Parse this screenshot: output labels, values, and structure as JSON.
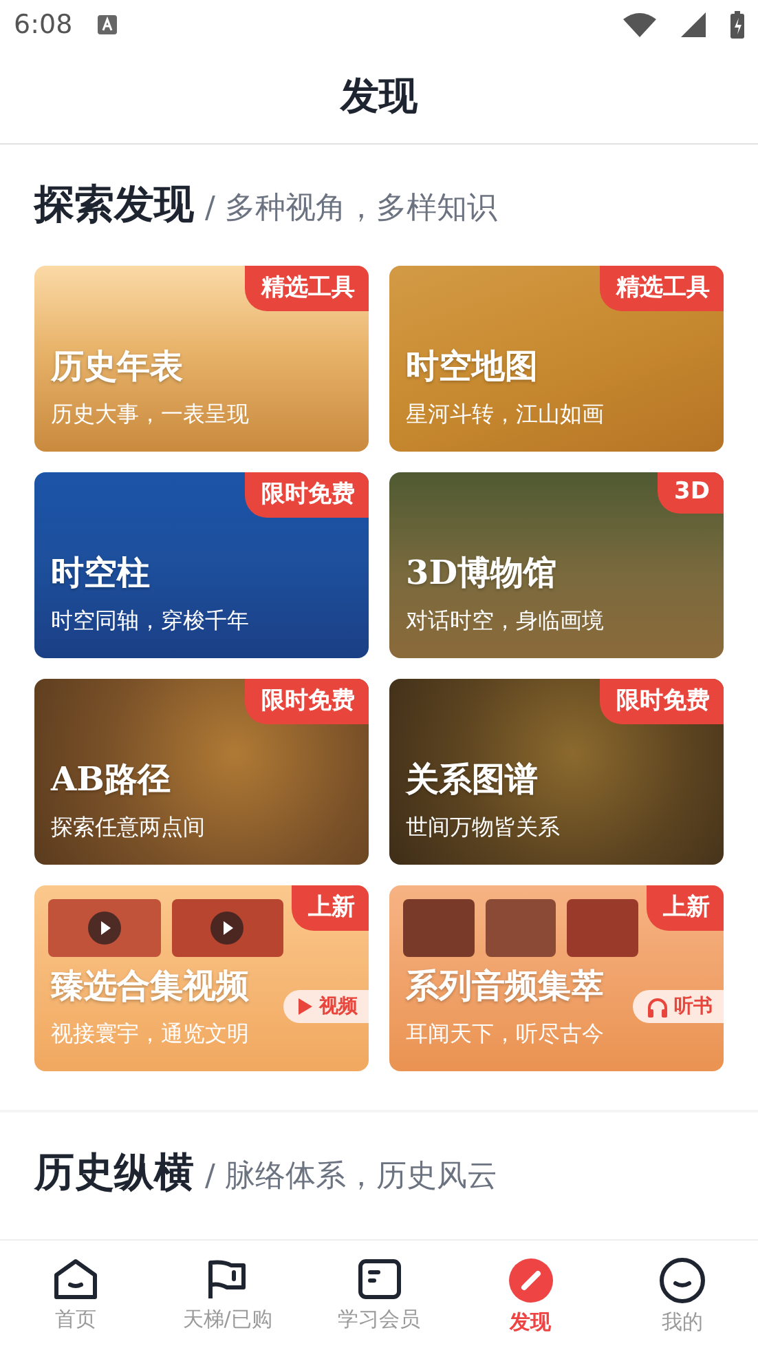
{
  "status_bar": {
    "time": "6:08"
  },
  "header": {
    "title": "发现"
  },
  "sections": [
    {
      "title": "探索发现",
      "subtitle": "/ 多种视角，多样知识",
      "cards": [
        {
          "kind": "tool",
          "title": "历史年表",
          "subtitle": "历史大事，一表呈现",
          "badge": "精选工具"
        },
        {
          "kind": "tool",
          "title": "时空地图",
          "subtitle": "星河斗转，江山如画",
          "badge": "精选工具"
        },
        {
          "kind": "tool",
          "title": "时空柱",
          "subtitle": "时空同轴，穿梭千年",
          "badge": "限时免费"
        },
        {
          "kind": "tool",
          "title": "3D博物馆",
          "subtitle": "对话时空，身临画境",
          "badge": "3D"
        },
        {
          "kind": "tool",
          "title": "AB路径",
          "subtitle": "探索任意两点间",
          "badge": "限时免费"
        },
        {
          "kind": "tool",
          "title": "关系图谱",
          "subtitle": "世间万物皆关系",
          "badge": "限时免费"
        },
        {
          "kind": "video",
          "title": "臻选合集视频",
          "subtitle": "视接寰宇，通览文明",
          "badge": "上新",
          "chip": "视频"
        },
        {
          "kind": "audio",
          "title": "系列音频集萃",
          "subtitle": "耳闻天下，听尽古今",
          "badge": "上新",
          "chip": "听书"
        }
      ]
    },
    {
      "title": "历史纵横",
      "subtitle": "/ 脉络体系，历史风云"
    }
  ],
  "tab_bar": [
    {
      "kind": "home",
      "label": "首页",
      "selected": false
    },
    {
      "kind": "flag",
      "label": "天梯/已购",
      "selected": false
    },
    {
      "kind": "book",
      "label": "学习会员",
      "selected": false
    },
    {
      "kind": "compass",
      "label": "发现",
      "selected": true
    },
    {
      "kind": "profile",
      "label": "我的",
      "selected": false
    }
  ]
}
